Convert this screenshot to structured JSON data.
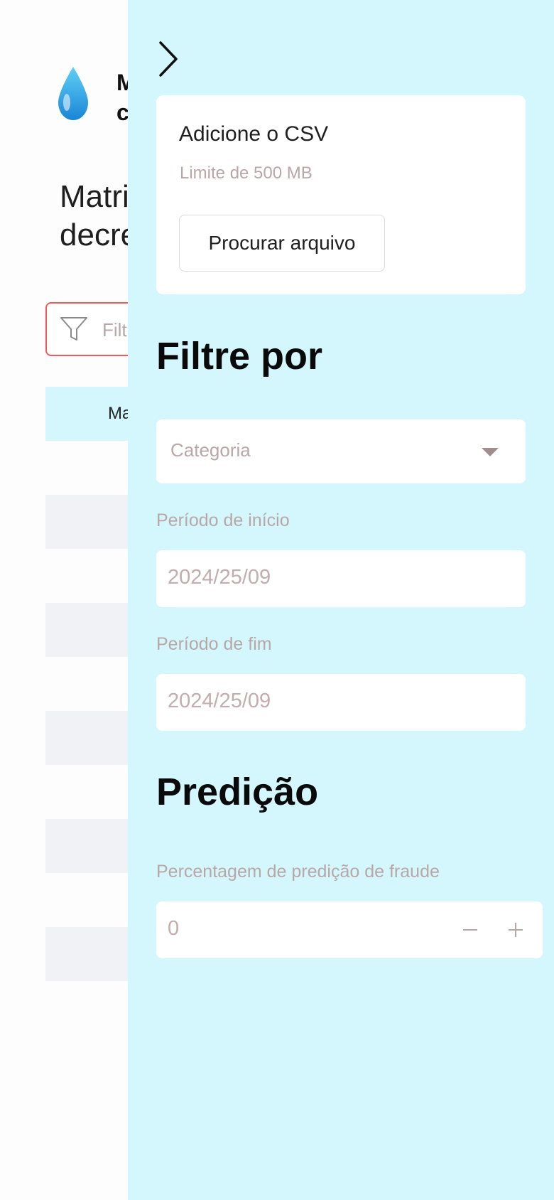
{
  "main": {
    "app_title": "M\nc",
    "page_title": "Matri\ndecre",
    "filter_placeholder": "Filt",
    "table_header": "Ma",
    "accent_color": "#f05a5a",
    "header_bg": "#d3f7fd",
    "stripe_bg": "#f0f2f6"
  },
  "sidebar": {
    "background": "#d3f7fd",
    "collapse_icon": "chevron-right-icon",
    "upload": {
      "title": "Adicione o CSV",
      "limit": "Limite de 500 MB",
      "button_label": "Procurar arquivo"
    },
    "filter_section_title": "Filtre por",
    "category_placeholder": "Categoria",
    "start_label": "Período de início",
    "start_value": "2024/25/09",
    "end_label": "Período de fim",
    "end_value": "2024/25/09",
    "prediction_section_title": "Predição",
    "fraud_label": "Percentagem de predição de fraude",
    "fraud_value": "0"
  }
}
